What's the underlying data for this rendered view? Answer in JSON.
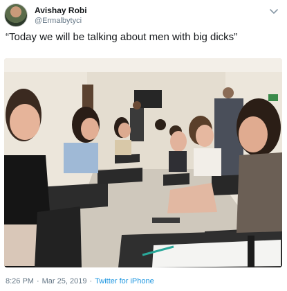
{
  "author": {
    "display_name": "Avishay Robi",
    "handle": "@Ermalbytyci"
  },
  "tweet": {
    "text": "“Today we will be talking about men with big dicks”"
  },
  "footer": {
    "time": "8:26 PM",
    "separator1": "·",
    "date": "Mar 25, 2019",
    "separator2": "·",
    "source": "Twitter for iPhone"
  },
  "icons": {
    "menu": "chevron-down-icon"
  },
  "colors": {
    "link": "#1b95e0",
    "secondary_text": "#657786"
  }
}
